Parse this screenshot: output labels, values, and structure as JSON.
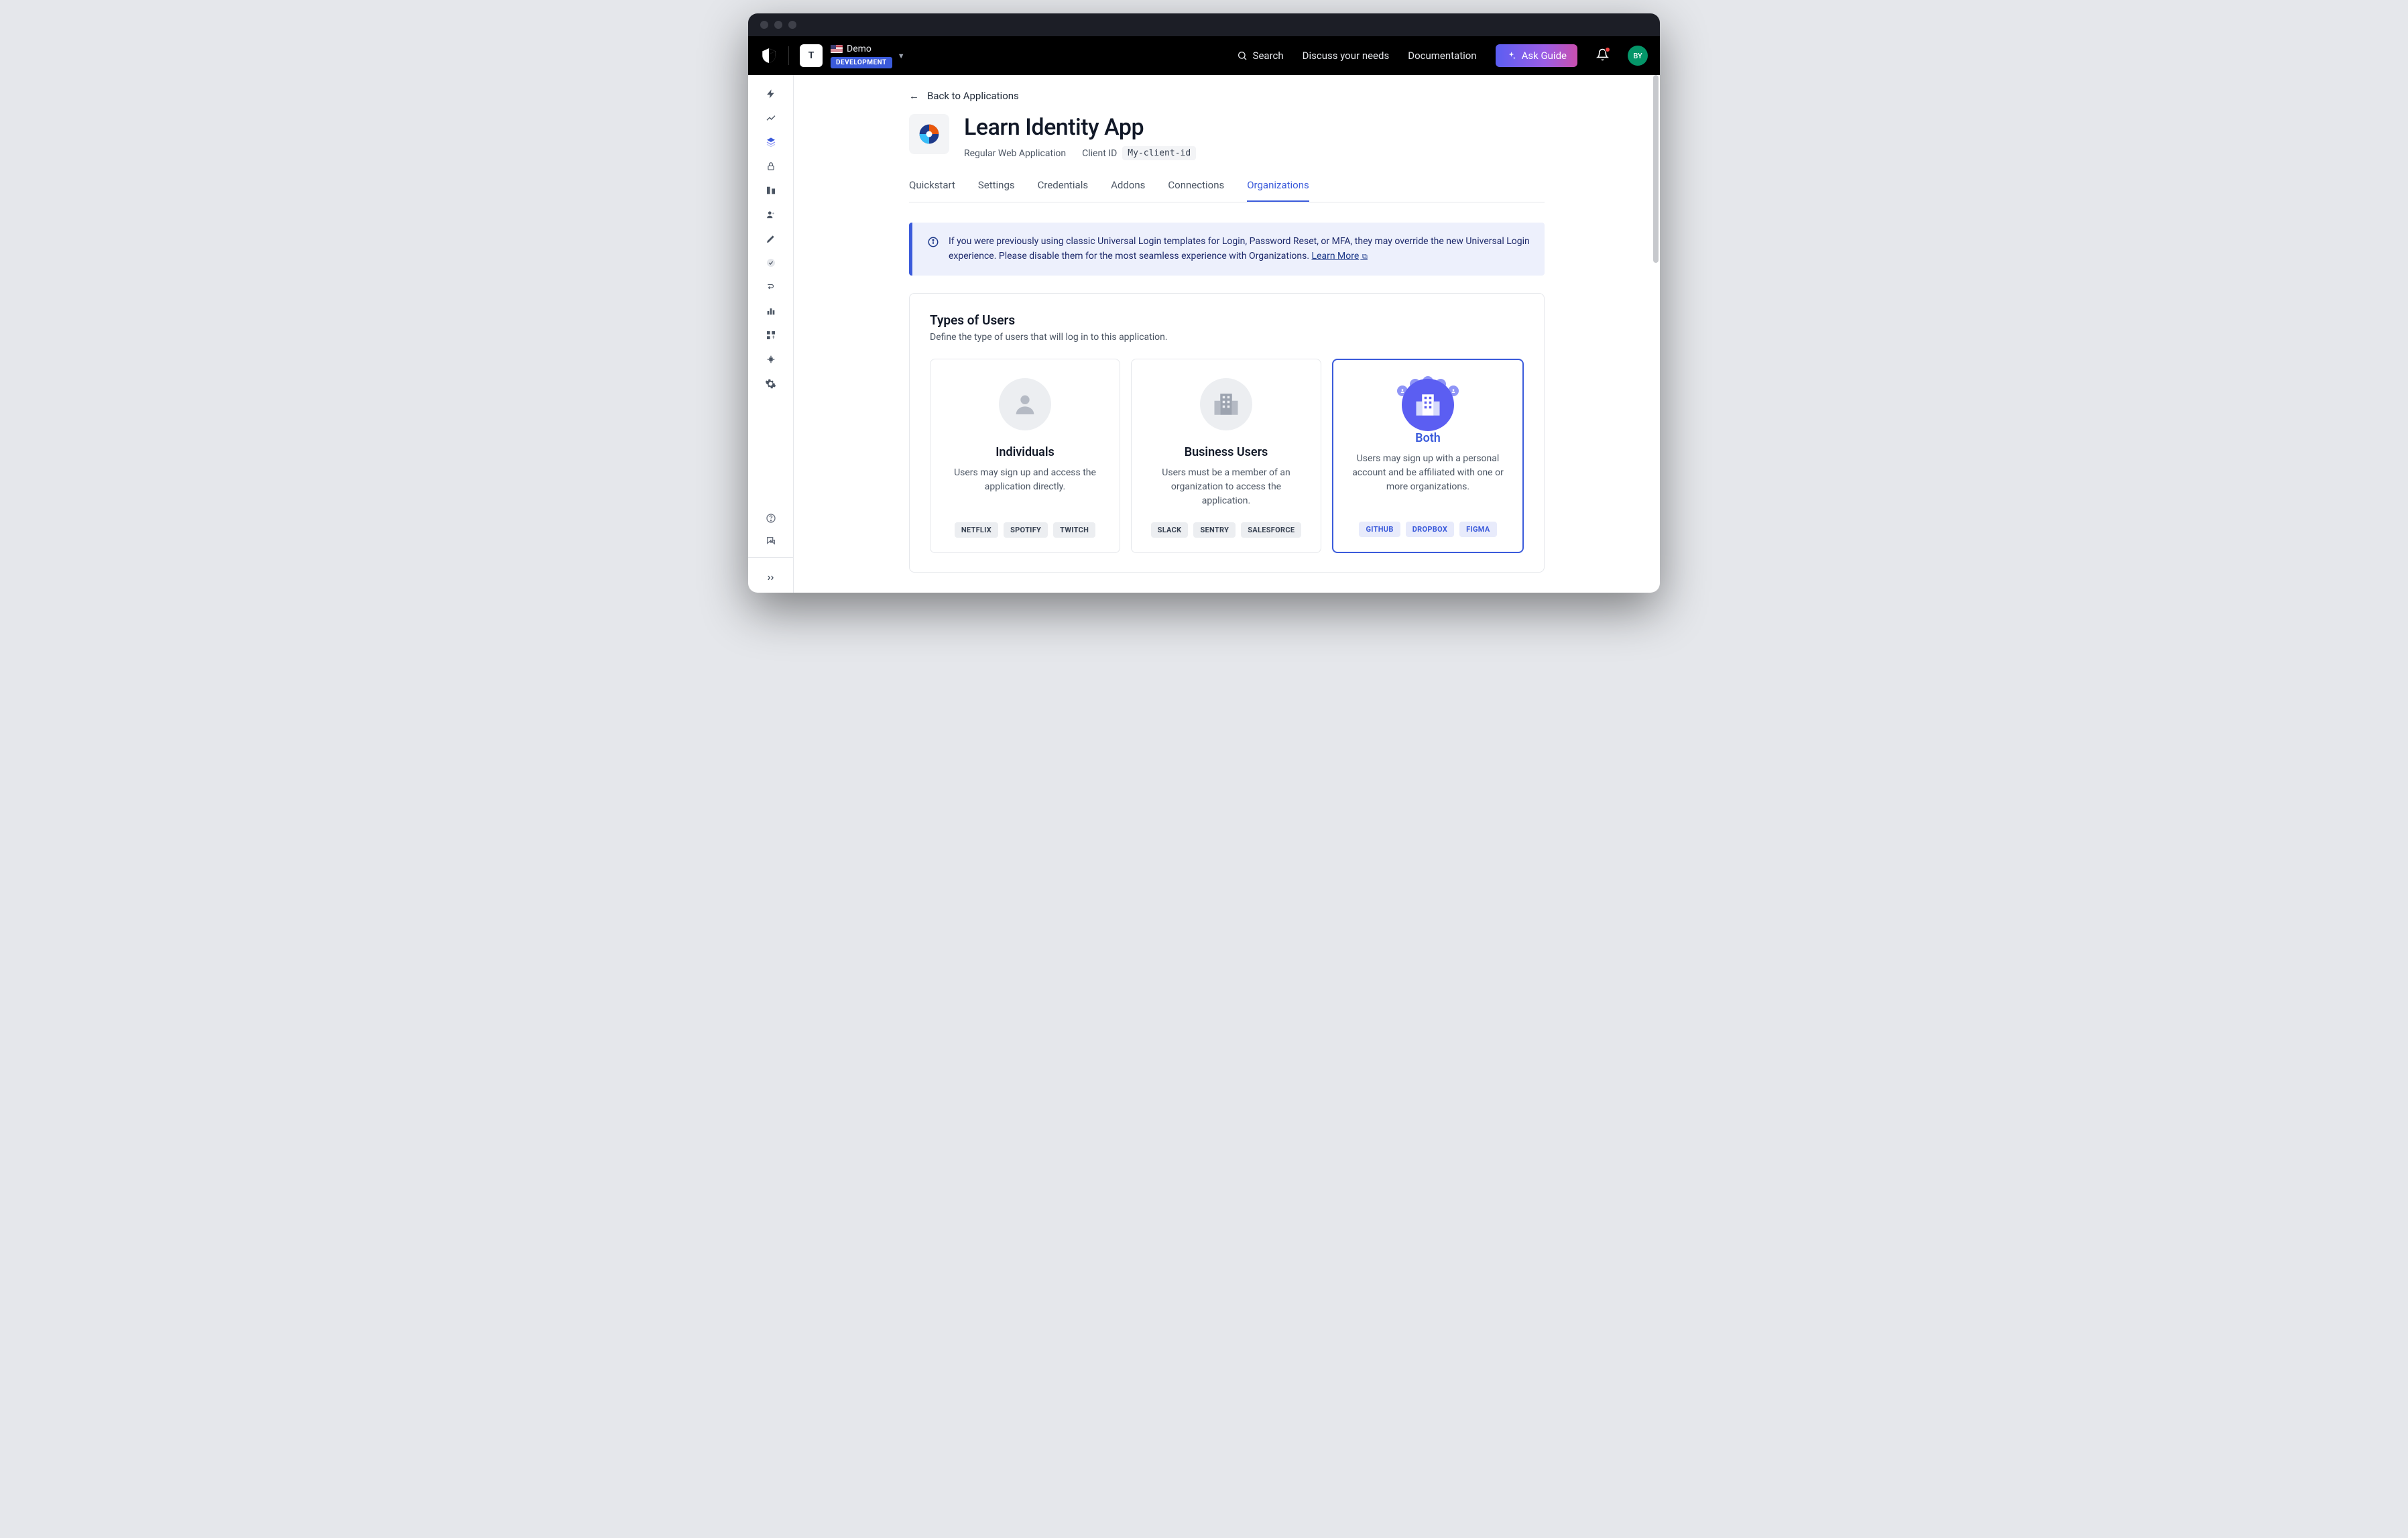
{
  "tenant": {
    "letter": "T",
    "name": "Demo",
    "env_badge": "DEVELOPMENT"
  },
  "topbar": {
    "search": "Search",
    "discuss": "Discuss your needs",
    "docs": "Documentation",
    "ask_guide": "Ask Guide",
    "avatar": "BY"
  },
  "back_link": "Back to Applications",
  "app": {
    "title": "Learn Identity App",
    "type": "Regular Web Application",
    "client_id_label": "Client ID",
    "client_id": "My-client-id"
  },
  "tabs": [
    "Quickstart",
    "Settings",
    "Credentials",
    "Addons",
    "Connections",
    "Organizations"
  ],
  "active_tab": "Organizations",
  "callout": {
    "text": "If you were previously using classic Universal Login templates for Login, Password Reset, or MFA, they may override the new Universal Login experience. Please disable them for the most seamless experience with Organizations. ",
    "link": "Learn More"
  },
  "users_section": {
    "title": "Types of Users",
    "sub": "Define the type of users that will log in to this application."
  },
  "cards": [
    {
      "title": "Individuals",
      "desc": "Users may sign up and access the application directly.",
      "pills": [
        "NETFLIX",
        "SPOTIFY",
        "TWITCH"
      ],
      "selected": false
    },
    {
      "title": "Business Users",
      "desc": "Users must be a member of an organization to access the application.",
      "pills": [
        "SLACK",
        "SENTRY",
        "SALESFORCE"
      ],
      "selected": false
    },
    {
      "title": "Both",
      "desc": "Users may sign up with a personal account and be affiliated with one or more organizations.",
      "pills": [
        "GITHUB",
        "DROPBOX",
        "FIGMA"
      ],
      "selected": true
    }
  ]
}
